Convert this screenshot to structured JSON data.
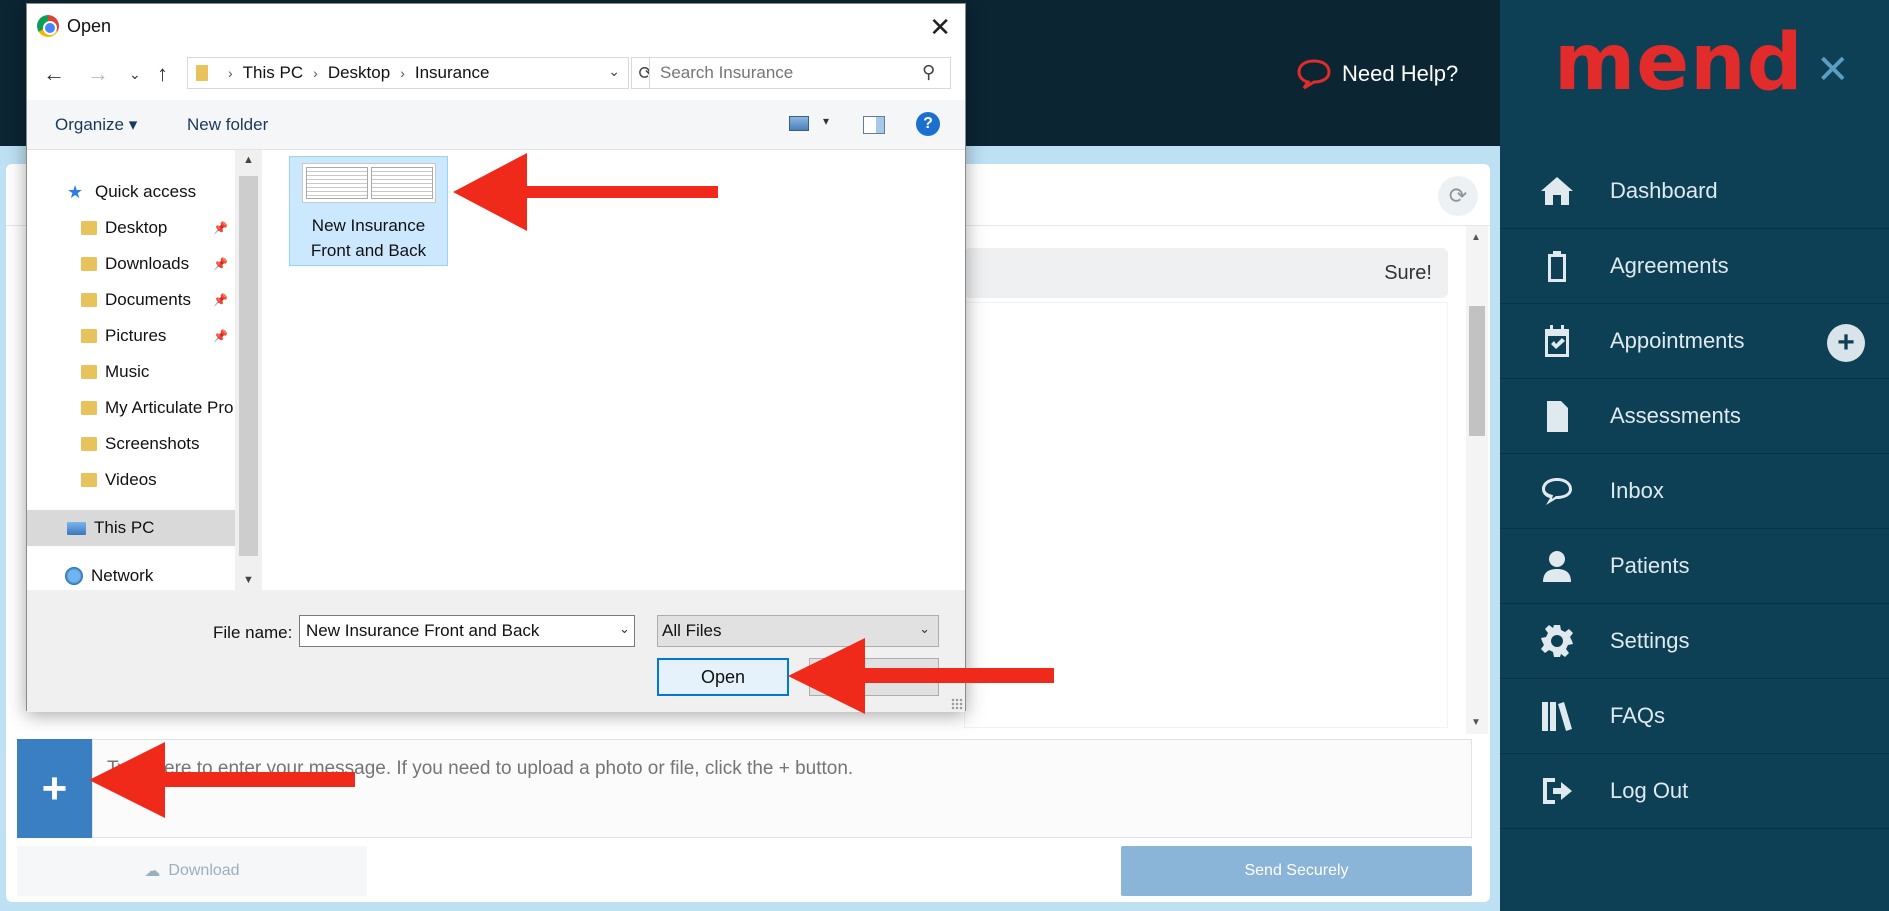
{
  "header": {
    "need_help": "Need Help?"
  },
  "sidebar": {
    "brand": "mend",
    "items": [
      {
        "label": "Dashboard",
        "icon": "home-icon"
      },
      {
        "label": "Agreements",
        "icon": "clipboard-icon"
      },
      {
        "label": "Appointments",
        "icon": "calendar-check-icon"
      },
      {
        "label": "Assessments",
        "icon": "document-icon"
      },
      {
        "label": "Inbox",
        "icon": "chat-icon"
      },
      {
        "label": "Patients",
        "icon": "user-icon"
      },
      {
        "label": "Settings",
        "icon": "gear-icon"
      },
      {
        "label": "FAQs",
        "icon": "books-icon"
      },
      {
        "label": "Log Out",
        "icon": "sign-out-icon"
      }
    ],
    "add_symbol": "+"
  },
  "chat": {
    "message": "Sure!",
    "input_placeholder": "Type here to enter your message. If you need to upload a photo or file, click the + button.",
    "download_label": "Download",
    "send_label": "Send Securely",
    "plus_label": "+"
  },
  "dialog": {
    "title": "Open",
    "breadcrumb": [
      "This PC",
      "Desktop",
      "Insurance"
    ],
    "search_placeholder": "Search Insurance",
    "toolbar": {
      "organize": "Organize ▾",
      "new_folder": "New folder",
      "help": "?"
    },
    "tree": [
      {
        "label": "Quick access",
        "pinned": false
      },
      {
        "label": "Desktop",
        "pinned": true
      },
      {
        "label": "Downloads",
        "pinned": true
      },
      {
        "label": "Documents",
        "pinned": true
      },
      {
        "label": "Pictures",
        "pinned": true
      },
      {
        "label": "Music",
        "pinned": false
      },
      {
        "label": "My Articulate Pro",
        "pinned": false
      },
      {
        "label": "Screenshots",
        "pinned": false
      },
      {
        "label": "Videos",
        "pinned": false
      },
      {
        "label": "This PC",
        "pinned": false,
        "selected": true
      },
      {
        "label": "Network",
        "pinned": false
      }
    ],
    "file": {
      "name_line1": "New Insurance",
      "name_line2": "Front and Back"
    },
    "file_name_label": "File name:",
    "file_name_value": "New Insurance Front and Back",
    "file_type": "All Files",
    "open_label": "Open"
  },
  "colors": {
    "accent_red": "#e22b2b",
    "sidebar_bg": "#0d3f55",
    "header_bg": "#0b2533",
    "button_blue": "#3b7fc3"
  }
}
